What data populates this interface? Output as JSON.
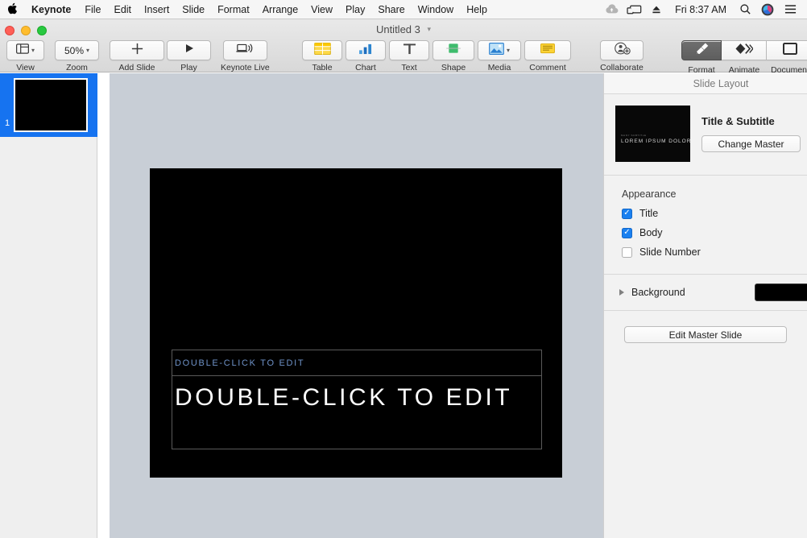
{
  "menubar": {
    "apple_icon": "apple-logo-icon",
    "items": [
      {
        "label": "Keynote",
        "bold": true
      },
      {
        "label": "File"
      },
      {
        "label": "Edit"
      },
      {
        "label": "Insert"
      },
      {
        "label": "Slide"
      },
      {
        "label": "Format"
      },
      {
        "label": "Arrange"
      },
      {
        "label": "View"
      },
      {
        "label": "Play"
      },
      {
        "label": "Share"
      },
      {
        "label": "Window"
      },
      {
        "label": "Help"
      }
    ],
    "status": {
      "cloud_icon": "cloud-upload-icon",
      "screen_icon": "screen-mirroring-icon",
      "eject_icon": "eject-icon",
      "clock": "Fri 8:37 AM",
      "search_icon": "search-icon",
      "siri_icon": "siri-icon",
      "notification_icon": "notification-center-icon"
    }
  },
  "window": {
    "title": "Untitled 3",
    "title_chevron": "chevron-down-icon",
    "traffic": {
      "close": "close-button",
      "minimize": "minimize-button",
      "zoom": "zoom-button"
    }
  },
  "toolbar": {
    "left_group": [
      {
        "label": "View",
        "icon": "view-layout-icon",
        "has_chevron": true
      },
      {
        "label": "Zoom",
        "icon": null,
        "value": "50%",
        "has_chevron": true
      },
      {
        "label": "Add Slide",
        "icon": "plus-icon",
        "has_chevron": false
      }
    ],
    "play_group": [
      {
        "label": "Play",
        "icon": "play-triangle-icon"
      },
      {
        "label": "Keynote Live",
        "icon": "keynote-live-icon"
      }
    ],
    "insert_group": [
      {
        "label": "Table",
        "icon": "table-icon"
      },
      {
        "label": "Chart",
        "icon": "chart-bar-icon"
      },
      {
        "label": "Text",
        "icon": "text-t-icon"
      },
      {
        "label": "Shape",
        "icon": "shape-icon"
      },
      {
        "label": "Media",
        "icon": "media-image-icon",
        "has_chevron": true
      },
      {
        "label": "Comment",
        "icon": "comment-icon"
      }
    ],
    "collaborate": {
      "label": "Collaborate",
      "icon": "collaborate-person-icon"
    },
    "inspector_group": [
      {
        "label": "Format",
        "icon": "format-brush-icon",
        "active": true
      },
      {
        "label": "Animate",
        "icon": "animate-diamond-icon",
        "active": false
      },
      {
        "label": "Document",
        "icon": "document-icon",
        "active": false
      }
    ]
  },
  "navigator": {
    "slides": [
      {
        "number": "1",
        "selected": true
      }
    ]
  },
  "canvas": {
    "slide": {
      "background_color": "#000000",
      "subtitle": {
        "text": "DOUBLE-CLICK TO EDIT",
        "color": "#6f93c9"
      },
      "title": {
        "text": "DOUBLE-CLICK TO EDIT",
        "color": "#ffffff"
      }
    }
  },
  "sidebar": {
    "header_title": "Slide Layout",
    "master": {
      "name": "Title & Subtitle",
      "change_button": "Change Master",
      "thumb_subtitle": "MANY SUBTITLE",
      "thumb_title": "LOREM IPSUM DOLOR"
    },
    "appearance": {
      "title": "Appearance",
      "options": [
        {
          "label": "Title",
          "checked": true
        },
        {
          "label": "Body",
          "checked": true
        },
        {
          "label": "Slide Number",
          "checked": false
        }
      ]
    },
    "background": {
      "label": "Background",
      "disclosure": "disclosure-triangle-icon",
      "swatch_color": "#000000"
    },
    "edit_master_button": "Edit Master Slide"
  },
  "colors": {
    "accent_blue": "#1673f0",
    "canvas_bg": "#c8ced6",
    "sidebar_bg": "#f2f2f2",
    "toolbar_bg": "#e2e2e2"
  }
}
